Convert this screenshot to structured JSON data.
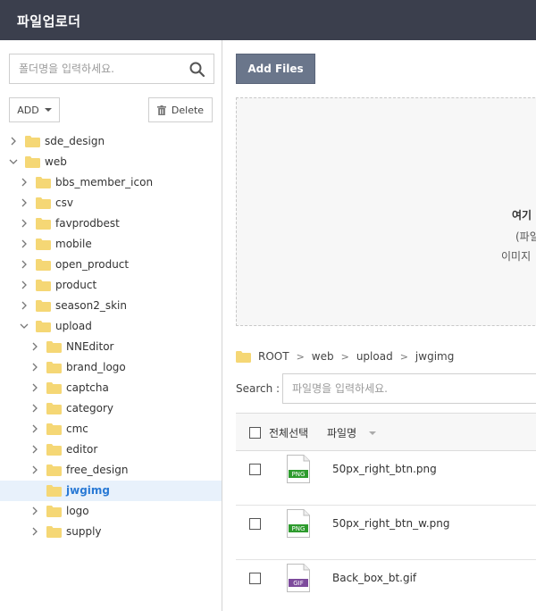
{
  "app": {
    "title": "파일업로더"
  },
  "sidebar": {
    "search": {
      "placeholder": "폴더명을 입력하세요.",
      "icon": "search-icon"
    },
    "add_label": "ADD",
    "delete_label": "Delete",
    "tree": [
      {
        "label": "sde_design",
        "level": 0,
        "expanded": false,
        "selected": false
      },
      {
        "label": "web",
        "level": 0,
        "expanded": true,
        "selected": false
      },
      {
        "label": "bbs_member_icon",
        "level": 1,
        "expanded": false,
        "selected": false
      },
      {
        "label": "csv",
        "level": 1,
        "expanded": false,
        "selected": false
      },
      {
        "label": "favprodbest",
        "level": 1,
        "expanded": false,
        "selected": false
      },
      {
        "label": "mobile",
        "level": 1,
        "expanded": false,
        "selected": false
      },
      {
        "label": "open_product",
        "level": 1,
        "expanded": false,
        "selected": false
      },
      {
        "label": "product",
        "level": 1,
        "expanded": false,
        "selected": false
      },
      {
        "label": "season2_skin",
        "level": 1,
        "expanded": false,
        "selected": false
      },
      {
        "label": "upload",
        "level": 1,
        "expanded": true,
        "selected": false
      },
      {
        "label": "NNEditor",
        "level": 2,
        "expanded": false,
        "selected": false
      },
      {
        "label": "brand_logo",
        "level": 2,
        "expanded": false,
        "selected": false
      },
      {
        "label": "captcha",
        "level": 2,
        "expanded": false,
        "selected": false
      },
      {
        "label": "category",
        "level": 2,
        "expanded": false,
        "selected": false
      },
      {
        "label": "cmc",
        "level": 2,
        "expanded": false,
        "selected": false
      },
      {
        "label": "editor",
        "level": 2,
        "expanded": false,
        "selected": false
      },
      {
        "label": "free_design",
        "level": 2,
        "expanded": false,
        "selected": false
      },
      {
        "label": "jwgimg",
        "level": 2,
        "expanded": false,
        "selected": true,
        "no_arrow": true
      },
      {
        "label": "logo",
        "level": 2,
        "expanded": false,
        "selected": false
      },
      {
        "label": "supply",
        "level": 2,
        "expanded": false,
        "selected": false
      }
    ]
  },
  "main": {
    "add_files_label": "Add Files",
    "dropzone": {
      "line1": "여기",
      "line2": "(파일",
      "line3": "이미지"
    },
    "breadcrumb": [
      "ROOT",
      "web",
      "upload",
      "jwgimg"
    ],
    "search": {
      "label": "Search :",
      "placeholder": "파일명을 입력하세요."
    },
    "table": {
      "select_all_label": "전체선택",
      "filename_header": "파일명",
      "rows": [
        {
          "name": "50px_right_btn.png",
          "type": "PNG",
          "badge_color": "#2e9b2e"
        },
        {
          "name": "50px_right_btn_w.png",
          "type": "PNG",
          "badge_color": "#2e9b2e"
        },
        {
          "name": "Back_box_bt.gif",
          "type": "GIF",
          "badge_color": "#7d4b9c"
        }
      ]
    }
  },
  "colors": {
    "topbar": "#3b3f4d",
    "accent": "#2a7ad5",
    "selected_row": "#e8f1fb",
    "add_files_button": "#6a768b",
    "folder": "#f5d775"
  }
}
